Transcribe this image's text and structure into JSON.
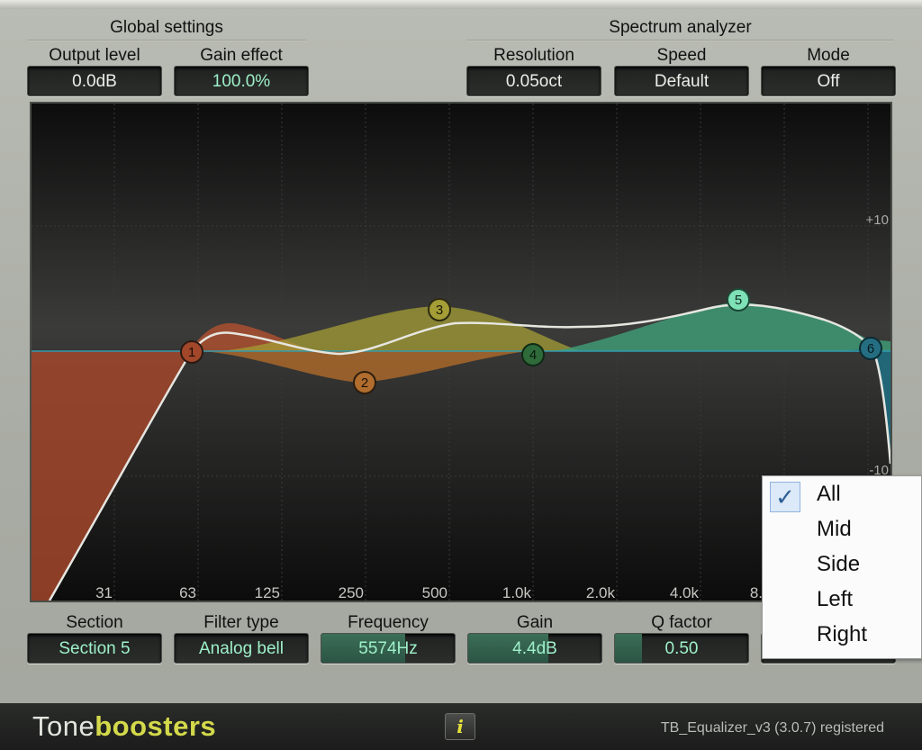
{
  "global_settings": {
    "title": "Global settings",
    "output_level": {
      "label": "Output level",
      "value": "0.0dB"
    },
    "gain_effect": {
      "label": "Gain effect",
      "value": "100.0%"
    }
  },
  "spectrum_analyzer": {
    "title": "Spectrum analyzer",
    "resolution": {
      "label": "Resolution",
      "value": "0.05oct"
    },
    "speed": {
      "label": "Speed",
      "value": "Default"
    },
    "mode": {
      "label": "Mode",
      "value": "Off"
    }
  },
  "graph": {
    "db_labels": [
      "+10",
      "-10"
    ],
    "freq_labels": [
      "31",
      "63",
      "125",
      "250",
      "500",
      "1.0k",
      "2.0k",
      "4.0k",
      "8."
    ],
    "bands": [
      {
        "id": "1",
        "color": "#c0502e"
      },
      {
        "id": "2",
        "color": "#c47a2e"
      },
      {
        "id": "3",
        "color": "#b5ab38"
      },
      {
        "id": "4",
        "color": "#4e9b55"
      },
      {
        "id": "5",
        "color": "#5fc89a"
      },
      {
        "id": "6",
        "color": "#2a8fa8"
      }
    ]
  },
  "section_controls": {
    "section": {
      "label": "Section",
      "value": "Section 5"
    },
    "filter_type": {
      "label": "Filter type",
      "value": "Analog bell"
    },
    "frequency": {
      "label": "Frequency",
      "value": "5574Hz",
      "fill": 0.63
    },
    "gain": {
      "label": "Gain",
      "value": "4.4dB",
      "fill": 0.6
    },
    "q_factor": {
      "label": "Q factor",
      "value": "0.50",
      "fill": 0.2
    }
  },
  "channel_menu": {
    "items": [
      "All",
      "Mid",
      "Side",
      "Left",
      "Right"
    ],
    "checked": "All",
    "check_glyph": "✓"
  },
  "footer": {
    "logo_part1": "Tone",
    "logo_part2": "boosters",
    "info_label": "i",
    "version": "TB_Equalizer_v3 (3.0.7) registered"
  },
  "colors": {
    "accent_yellow": "#d3d94a",
    "value_green": "#9ef0c9"
  }
}
